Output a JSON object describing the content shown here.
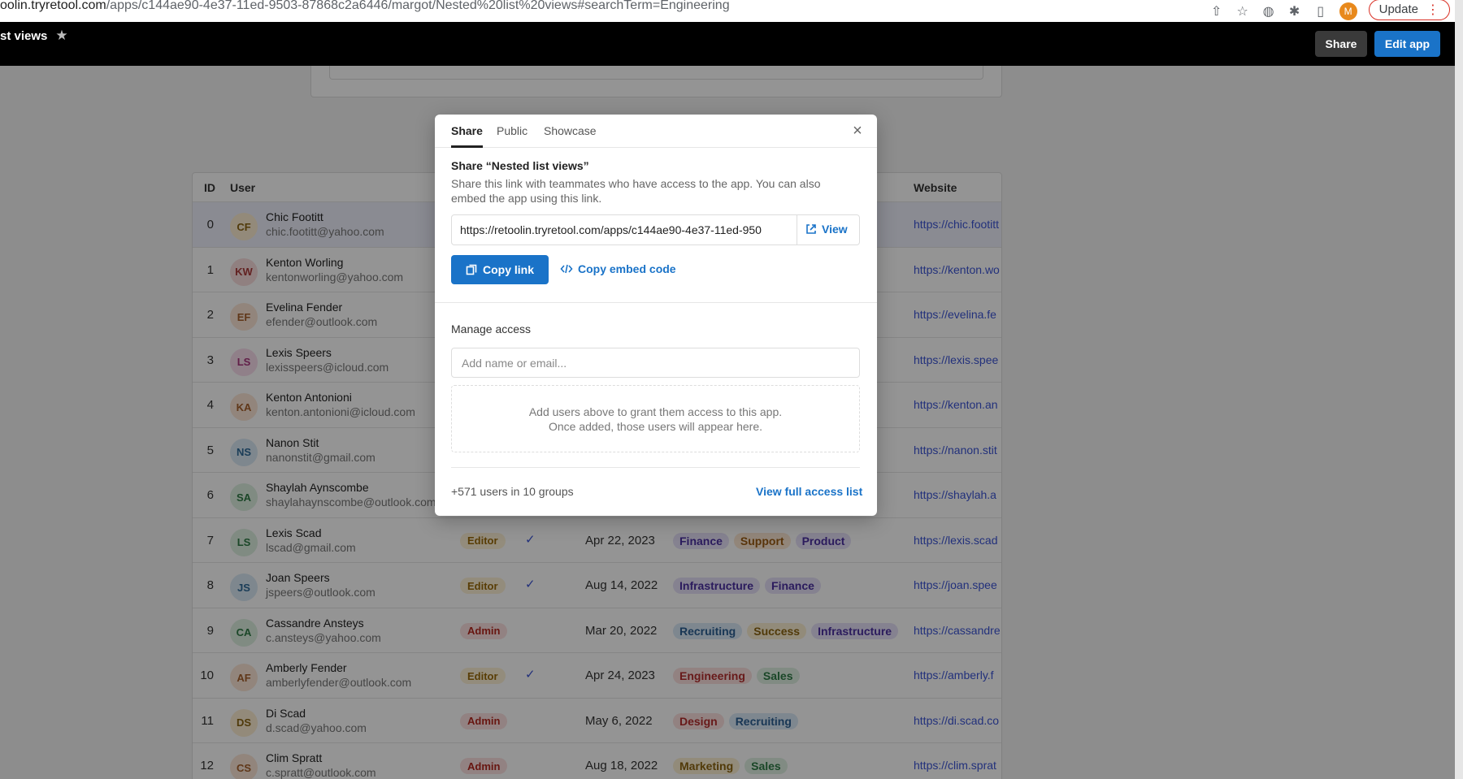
{
  "browser": {
    "url_host": "oolin.tryretool.com",
    "url_path": "/apps/c144ae90-4e37-11ed-9503-87868c2a6446/margot/Nested%20list%20views#searchTerm=Engineering",
    "profile_initial": "M",
    "update_label": "Update"
  },
  "app": {
    "title": "st views",
    "share_label": "Share",
    "edit_label": "Edit app"
  },
  "table": {
    "headers": {
      "id": "ID",
      "user": "User",
      "website": "Website"
    },
    "rows": [
      {
        "id": "0",
        "initials": "CF",
        "name": "Chic Footitt",
        "email": "chic.footitt@yahoo.com",
        "role": "",
        "enabled": "",
        "date": "",
        "tags": [],
        "website": "https://chic.footitt"
      },
      {
        "id": "1",
        "initials": "KW",
        "name": "Kenton Worling",
        "email": "kentonworling@yahoo.com",
        "role": "",
        "enabled": "",
        "date": "",
        "tags": [],
        "website": "https://kenton.wo"
      },
      {
        "id": "2",
        "initials": "EF",
        "name": "Evelina Fender",
        "email": "efender@outlook.com",
        "role": "",
        "enabled": "",
        "date": "",
        "tags": [],
        "website": "https://evelina.fe"
      },
      {
        "id": "3",
        "initials": "LS",
        "name": "Lexis Speers",
        "email": "lexisspeers@icloud.com",
        "role": "",
        "enabled": "",
        "date": "",
        "tags": [],
        "website": "https://lexis.spee"
      },
      {
        "id": "4",
        "initials": "KA",
        "name": "Kenton Antonioni",
        "email": "kenton.antonioni@icloud.com",
        "role": "",
        "enabled": "",
        "date": "",
        "tags": [],
        "website": "https://kenton.an"
      },
      {
        "id": "5",
        "initials": "NS",
        "name": "Nanon Stit",
        "email": "nanonstit@gmail.com",
        "role": "",
        "enabled": "",
        "date": "",
        "tags": [],
        "website": "https://nanon.stit"
      },
      {
        "id": "6",
        "initials": "SA",
        "name": "Shaylah Aynscombe",
        "email": "shaylahaynscombe@outlook.com",
        "role": "",
        "enabled": "",
        "date": "",
        "tags": [],
        "website": "https://shaylah.a"
      },
      {
        "id": "7",
        "initials": "LS",
        "name": "Lexis Scad",
        "email": "lscad@gmail.com",
        "role": "Editor",
        "enabled": "✓",
        "date": "Apr 22, 2023",
        "tags": [
          "Finance",
          "Support",
          "Product"
        ],
        "website": "https://lexis.scad"
      },
      {
        "id": "8",
        "initials": "JS",
        "name": "Joan Speers",
        "email": "jspeers@outlook.com",
        "role": "Editor",
        "enabled": "✓",
        "date": "Aug 14, 2022",
        "tags": [
          "Infrastructure",
          "Finance"
        ],
        "website": "https://joan.spee"
      },
      {
        "id": "9",
        "initials": "CA",
        "name": "Cassandre Ansteys",
        "email": "c.ansteys@yahoo.com",
        "role": "Admin",
        "enabled": "",
        "date": "Mar 20, 2022",
        "tags": [
          "Recruiting",
          "Success",
          "Infrastructure"
        ],
        "website": "https://cassandre"
      },
      {
        "id": "10",
        "initials": "AF",
        "name": "Amberly Fender",
        "email": "amberlyfender@outlook.com",
        "role": "Editor",
        "enabled": "✓",
        "date": "Apr 24, 2023",
        "tags": [
          "Engineering",
          "Sales"
        ],
        "website": "https://amberly.f"
      },
      {
        "id": "11",
        "initials": "DS",
        "name": "Di Scad",
        "email": "d.scad@yahoo.com",
        "role": "Admin",
        "enabled": "",
        "date": "May 6, 2022",
        "tags": [
          "Design",
          "Recruiting"
        ],
        "website": "https://di.scad.co"
      },
      {
        "id": "12",
        "initials": "CS",
        "name": "Clim Spratt",
        "email": "c.spratt@outlook.com",
        "role": "Admin",
        "enabled": "",
        "date": "Aug 18, 2022",
        "tags": [
          "Marketing",
          "Sales"
        ],
        "website": "https://clim.sprat"
      }
    ]
  },
  "modal": {
    "tabs": [
      "Share",
      "Public",
      "Showcase"
    ],
    "title": "Share “Nested list views”",
    "description": "Share this link with teammates who have access to the app. You can also embed the app using this link.",
    "link_value": "https://retoolin.tryretool.com/apps/c144ae90-4e37-11ed-950",
    "view_label": "View",
    "copy_link_label": "Copy link",
    "copy_embed_label": "Copy embed code",
    "manage_access_title": "Manage access",
    "add_placeholder": "Add name or email...",
    "empty_line1": "Add users above to grant them access to this app.",
    "empty_line2": "Once added, those users will appear here.",
    "users_count": "+571 users in 10 groups",
    "view_full_label": "View full access list"
  },
  "colors": {
    "accent": "#1a73c8",
    "link": "#3b54d4"
  },
  "avatar_palettes": [
    "#fdeed2|#8a6412",
    "#f9dcdc|#a93a3a",
    "#fbe6d6|#a5602b",
    "#f8dced|#a8357c",
    "#d9e9f5|#2e6a98",
    "#dcefe0|#2f7a45",
    "#e6e1f5|#5b3ea8"
  ],
  "tag_palettes": {
    "Finance": "#e6e1f8|#4a2fa0",
    "Support": "#fbe7d3|#9a5a12",
    "Product": "#e6e1f8|#4a2fa0",
    "Infrastructure": "#e6e1f8|#4a2fa0",
    "Recruiting": "#d9e8f6|#2b5f93",
    "Success": "#fbefd3|#8c6410",
    "Engineering": "#fbe0df|#b32e2e",
    "Sales": "#dff0e2|#2e7a45",
    "Design": "#fbe0df|#b32e2e",
    "Marketing": "#fbefd3|#8c6410"
  }
}
